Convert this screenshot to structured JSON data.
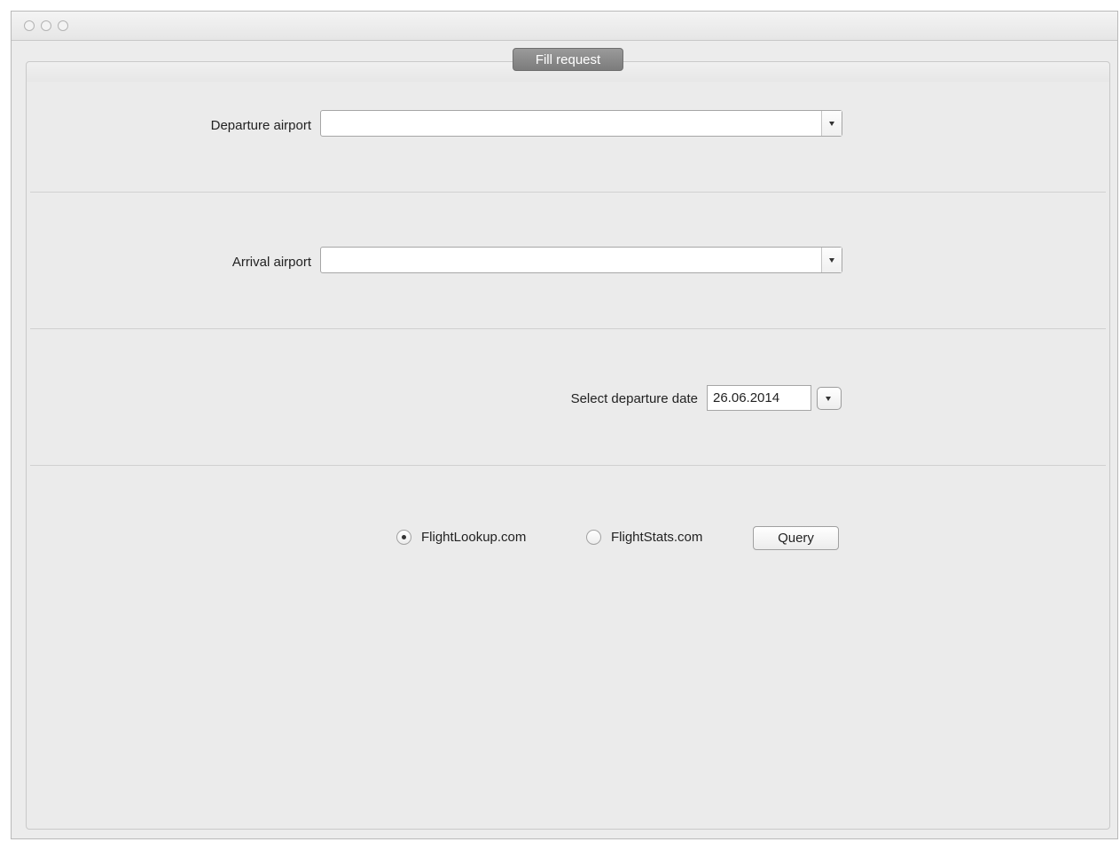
{
  "window": {
    "tab_title": "Fill request"
  },
  "form": {
    "departure_label": "Departure airport",
    "departure_value": "",
    "arrival_label": "Arrival airport",
    "arrival_value": "",
    "date_label": "Select departure date",
    "date_value": "26.06.2014"
  },
  "sources": {
    "options": [
      {
        "label": "FlightLookup.com",
        "selected": true
      },
      {
        "label": "FlightStats.com",
        "selected": false
      }
    ],
    "query_label": "Query"
  },
  "icons": {
    "window_controls": [
      "close-icon",
      "minimize-icon",
      "zoom-icon"
    ],
    "dropdown": "chevron-down-icon"
  }
}
